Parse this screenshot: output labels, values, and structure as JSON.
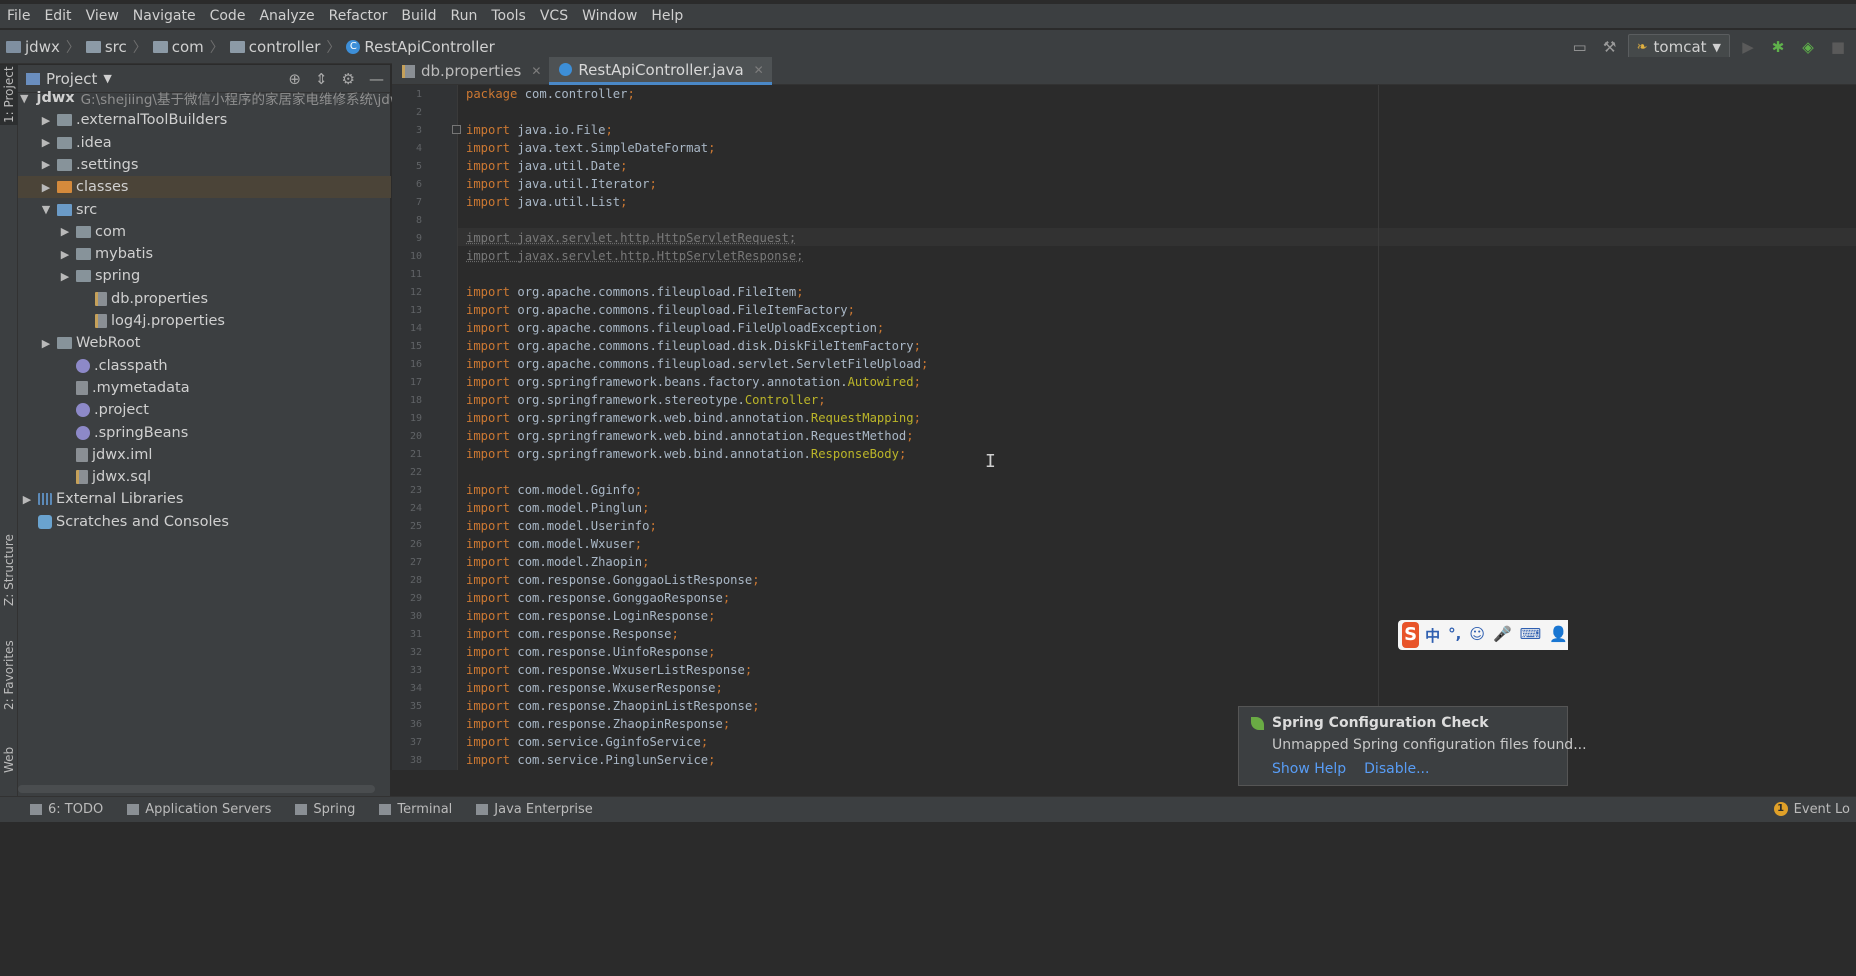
{
  "menu": [
    "File",
    "Edit",
    "View",
    "Navigate",
    "Code",
    "Analyze",
    "Refactor",
    "Build",
    "Run",
    "Tools",
    "VCS",
    "Window",
    "Help"
  ],
  "breadcrumb": [
    "jdwx",
    "src",
    "com",
    "controller",
    "RestApiController"
  ],
  "run_config": "tomcat",
  "project_panel": {
    "title": "Project",
    "tree": [
      {
        "label": "jdwx",
        "path": "G:\\shejiing\\基于微信小程序的家居家电维修系统\\jdw",
        "icon": "module-folder-icon",
        "depth": 0,
        "arrow": "▼"
      },
      {
        "label": ".externalToolBuilders",
        "icon": "folder-icon",
        "depth": 1,
        "arrow": "▶"
      },
      {
        "label": ".idea",
        "icon": "folder-icon",
        "depth": 1,
        "arrow": "▶"
      },
      {
        "label": ".settings",
        "icon": "folder-icon",
        "depth": 1,
        "arrow": "▶"
      },
      {
        "label": "classes",
        "icon": "excluded-folder-icon",
        "depth": 1,
        "arrow": "▶",
        "selected": true
      },
      {
        "label": "src",
        "icon": "source-folder-icon",
        "depth": 1,
        "arrow": "▼"
      },
      {
        "label": "com",
        "icon": "package-icon",
        "depth": 2,
        "arrow": "▶"
      },
      {
        "label": "mybatis",
        "icon": "package-icon",
        "depth": 2,
        "arrow": "▶"
      },
      {
        "label": "spring",
        "icon": "package-icon",
        "depth": 2,
        "arrow": "▶"
      },
      {
        "label": "db.properties",
        "icon": "properties-file-icon",
        "depth": 3,
        "arrow": ""
      },
      {
        "label": "log4j.properties",
        "icon": "properties-file-icon",
        "depth": 3,
        "arrow": ""
      },
      {
        "label": "WebRoot",
        "icon": "web-folder-icon",
        "depth": 1,
        "arrow": "▶"
      },
      {
        "label": ".classpath",
        "icon": "eclipse-file-icon",
        "depth": 2,
        "arrow": ""
      },
      {
        "label": ".mymetadata",
        "icon": "file-icon",
        "depth": 2,
        "arrow": ""
      },
      {
        "label": ".project",
        "icon": "eclipse-file-icon",
        "depth": 2,
        "arrow": ""
      },
      {
        "label": ".springBeans",
        "icon": "eclipse-file-icon",
        "depth": 2,
        "arrow": ""
      },
      {
        "label": "jdwx.iml",
        "icon": "file-icon",
        "depth": 2,
        "arrow": ""
      },
      {
        "label": "jdwx.sql",
        "icon": "sql-file-icon",
        "depth": 2,
        "arrow": ""
      },
      {
        "label": "External Libraries",
        "icon": "library-icon",
        "depth": 0,
        "arrow": "▶"
      },
      {
        "label": "Scratches and Consoles",
        "icon": "scratches-icon",
        "depth": 0,
        "arrow": ""
      }
    ]
  },
  "left_strip": [
    "1: Project",
    "Z: Structure",
    "2: Favorites",
    "Web"
  ],
  "tabs": [
    {
      "label": "db.properties",
      "icon": "properties-file-icon",
      "active": false
    },
    {
      "label": "RestApiController.java",
      "icon": "java-class-icon",
      "active": true
    }
  ],
  "code": [
    {
      "n": "1",
      "parts": [
        {
          "t": "package ",
          "k": "kw"
        },
        {
          "t": "com.controller",
          "k": ""
        },
        {
          "t": ";",
          "k": "kw"
        }
      ]
    },
    {
      "n": "2",
      "parts": []
    },
    {
      "n": "3",
      "parts": [
        {
          "t": "import ",
          "k": "kw"
        },
        {
          "t": "java.io.File",
          "k": ""
        },
        {
          "t": ";",
          "k": "kw"
        }
      ]
    },
    {
      "n": "4",
      "parts": [
        {
          "t": "import ",
          "k": "kw"
        },
        {
          "t": "java.text.SimpleDateFormat",
          "k": ""
        },
        {
          "t": ";",
          "k": "kw"
        }
      ]
    },
    {
      "n": "5",
      "parts": [
        {
          "t": "import ",
          "k": "kw"
        },
        {
          "t": "java.util.Date",
          "k": ""
        },
        {
          "t": ";",
          "k": "kw"
        }
      ]
    },
    {
      "n": "6",
      "parts": [
        {
          "t": "import ",
          "k": "kw"
        },
        {
          "t": "java.util.Iterator",
          "k": ""
        },
        {
          "t": ";",
          "k": "kw"
        }
      ]
    },
    {
      "n": "7",
      "parts": [
        {
          "t": "import ",
          "k": "kw"
        },
        {
          "t": "java.util.List",
          "k": ""
        },
        {
          "t": ";",
          "k": "kw"
        }
      ]
    },
    {
      "n": "8",
      "parts": []
    },
    {
      "n": "9",
      "parts": [
        {
          "t": "import javax.servlet.http.HttpServletRequest;",
          "k": "unused"
        }
      ]
    },
    {
      "n": "10",
      "parts": [
        {
          "t": "import javax.servlet.http.HttpServletResponse;",
          "k": "unused"
        }
      ]
    },
    {
      "n": "11",
      "parts": []
    },
    {
      "n": "12",
      "parts": [
        {
          "t": "import ",
          "k": "kw"
        },
        {
          "t": "org.apache.commons.fileupload.FileItem",
          "k": ""
        },
        {
          "t": ";",
          "k": "kw"
        }
      ]
    },
    {
      "n": "13",
      "parts": [
        {
          "t": "import ",
          "k": "kw"
        },
        {
          "t": "org.apache.commons.fileupload.FileItemFactory",
          "k": ""
        },
        {
          "t": ";",
          "k": "kw"
        }
      ]
    },
    {
      "n": "14",
      "parts": [
        {
          "t": "import ",
          "k": "kw"
        },
        {
          "t": "org.apache.commons.fileupload.FileUploadException",
          "k": ""
        },
        {
          "t": ";",
          "k": "kw"
        }
      ]
    },
    {
      "n": "15",
      "parts": [
        {
          "t": "import ",
          "k": "kw"
        },
        {
          "t": "org.apache.commons.fileupload.disk.DiskFileItemFactory",
          "k": ""
        },
        {
          "t": ";",
          "k": "kw"
        }
      ]
    },
    {
      "n": "16",
      "parts": [
        {
          "t": "import ",
          "k": "kw"
        },
        {
          "t": "org.apache.commons.fileupload.servlet.ServletFileUpload",
          "k": ""
        },
        {
          "t": ";",
          "k": "kw"
        }
      ]
    },
    {
      "n": "17",
      "parts": [
        {
          "t": "import ",
          "k": "kw"
        },
        {
          "t": "org.springframework.beans.factory.annotation.",
          "k": ""
        },
        {
          "t": "Autowired",
          "k": "ann"
        },
        {
          "t": ";",
          "k": "kw"
        }
      ]
    },
    {
      "n": "18",
      "parts": [
        {
          "t": "import ",
          "k": "kw"
        },
        {
          "t": "org.springframework.stereotype.",
          "k": ""
        },
        {
          "t": "Controller",
          "k": "ann"
        },
        {
          "t": ";",
          "k": "kw"
        }
      ]
    },
    {
      "n": "19",
      "parts": [
        {
          "t": "import ",
          "k": "kw"
        },
        {
          "t": "org.springframework.web.bind.annotation.",
          "k": ""
        },
        {
          "t": "RequestMapping",
          "k": "ann"
        },
        {
          "t": ";",
          "k": "kw"
        }
      ]
    },
    {
      "n": "20",
      "parts": [
        {
          "t": "import ",
          "k": "kw"
        },
        {
          "t": "org.springframework.web.bind.annotation.RequestMethod",
          "k": ""
        },
        {
          "t": ";",
          "k": "kw"
        }
      ]
    },
    {
      "n": "21",
      "parts": [
        {
          "t": "import ",
          "k": "kw"
        },
        {
          "t": "org.springframework.web.bind.annotation.",
          "k": ""
        },
        {
          "t": "ResponseBody",
          "k": "ann"
        },
        {
          "t": ";",
          "k": "kw"
        }
      ]
    },
    {
      "n": "22",
      "parts": []
    },
    {
      "n": "23",
      "parts": [
        {
          "t": "import ",
          "k": "kw"
        },
        {
          "t": "com.model.Gginfo",
          "k": ""
        },
        {
          "t": ";",
          "k": "kw"
        }
      ]
    },
    {
      "n": "24",
      "parts": [
        {
          "t": "import ",
          "k": "kw"
        },
        {
          "t": "com.model.Pinglun",
          "k": ""
        },
        {
          "t": ";",
          "k": "kw"
        }
      ]
    },
    {
      "n": "25",
      "parts": [
        {
          "t": "import ",
          "k": "kw"
        },
        {
          "t": "com.model.Userinfo",
          "k": ""
        },
        {
          "t": ";",
          "k": "kw"
        }
      ]
    },
    {
      "n": "26",
      "parts": [
        {
          "t": "import ",
          "k": "kw"
        },
        {
          "t": "com.model.Wxuser",
          "k": ""
        },
        {
          "t": ";",
          "k": "kw"
        }
      ]
    },
    {
      "n": "27",
      "parts": [
        {
          "t": "import ",
          "k": "kw"
        },
        {
          "t": "com.model.Zhaopin",
          "k": ""
        },
        {
          "t": ";",
          "k": "kw"
        }
      ]
    },
    {
      "n": "28",
      "parts": [
        {
          "t": "import ",
          "k": "kw"
        },
        {
          "t": "com.response.GonggaoListResponse",
          "k": ""
        },
        {
          "t": ";",
          "k": "kw"
        }
      ]
    },
    {
      "n": "29",
      "parts": [
        {
          "t": "import ",
          "k": "kw"
        },
        {
          "t": "com.response.GonggaoResponse",
          "k": ""
        },
        {
          "t": ";",
          "k": "kw"
        }
      ]
    },
    {
      "n": "30",
      "parts": [
        {
          "t": "import ",
          "k": "kw"
        },
        {
          "t": "com.response.LoginResponse",
          "k": ""
        },
        {
          "t": ";",
          "k": "kw"
        }
      ]
    },
    {
      "n": "31",
      "parts": [
        {
          "t": "import ",
          "k": "kw"
        },
        {
          "t": "com.response.Response",
          "k": ""
        },
        {
          "t": ";",
          "k": "kw"
        }
      ]
    },
    {
      "n": "32",
      "parts": [
        {
          "t": "import ",
          "k": "kw"
        },
        {
          "t": "com.response.UinfoResponse",
          "k": ""
        },
        {
          "t": ";",
          "k": "kw"
        }
      ]
    },
    {
      "n": "33",
      "parts": [
        {
          "t": "import ",
          "k": "kw"
        },
        {
          "t": "com.response.WxuserListResponse",
          "k": ""
        },
        {
          "t": ";",
          "k": "kw"
        }
      ]
    },
    {
      "n": "34",
      "parts": [
        {
          "t": "import ",
          "k": "kw"
        },
        {
          "t": "com.response.WxuserResponse",
          "k": ""
        },
        {
          "t": ";",
          "k": "kw"
        }
      ]
    },
    {
      "n": "35",
      "parts": [
        {
          "t": "import ",
          "k": "kw"
        },
        {
          "t": "com.response.ZhaopinListResponse",
          "k": ""
        },
        {
          "t": ";",
          "k": "kw"
        }
      ]
    },
    {
      "n": "36",
      "parts": [
        {
          "t": "import ",
          "k": "kw"
        },
        {
          "t": "com.response.ZhaopinResponse",
          "k": ""
        },
        {
          "t": ";",
          "k": "kw"
        }
      ]
    },
    {
      "n": "37",
      "parts": [
        {
          "t": "import ",
          "k": "kw"
        },
        {
          "t": "com.service.GginfoService",
          "k": ""
        },
        {
          "t": ";",
          "k": "kw"
        }
      ]
    },
    {
      "n": "38",
      "parts": [
        {
          "t": "import ",
          "k": "kw"
        },
        {
          "t": "com.service.PinglunService",
          "k": ""
        },
        {
          "t": ";",
          "k": "kw"
        }
      ]
    }
  ],
  "bottom_tabs": [
    {
      "label": "6: TODO",
      "icon": "todo-icon"
    },
    {
      "label": "Application Servers",
      "icon": "servers-icon"
    },
    {
      "label": "Spring",
      "icon": "spring-icon"
    },
    {
      "label": "Terminal",
      "icon": "terminal-icon"
    },
    {
      "label": "Java Enterprise",
      "icon": "java-enterprise-icon"
    }
  ],
  "event_log": {
    "label": "Event Lo",
    "count": "1"
  },
  "notification": {
    "title": "Spring Configuration Check",
    "message": "Unmapped Spring configuration files found...",
    "actions": [
      "Show Help",
      "Disable..."
    ]
  },
  "ime": {
    "logo": "S",
    "glyphs": [
      "中",
      "°,",
      "☺",
      "🎤",
      "⌨",
      "👤"
    ]
  },
  "colors": {
    "keyword": "#cc7832",
    "annotation": "#bbb529",
    "text": "#a9b7c6",
    "link": "#589df6",
    "selected_tab": "#4a88c7"
  }
}
